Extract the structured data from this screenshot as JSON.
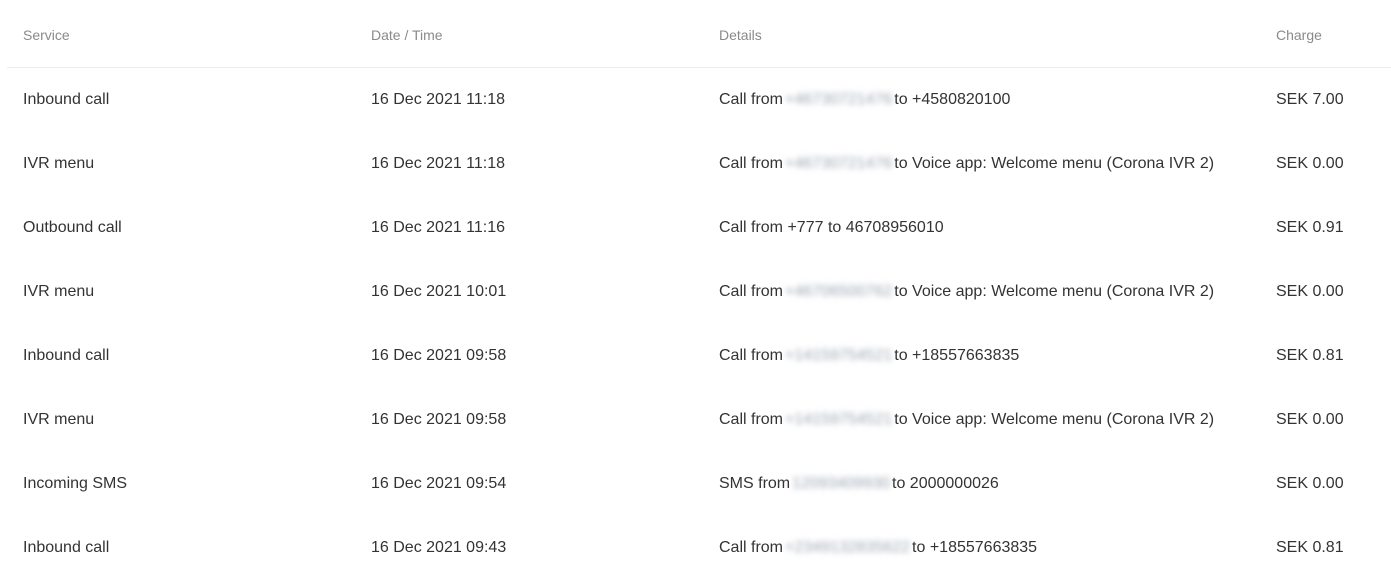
{
  "table": {
    "headers": {
      "service": "Service",
      "date_time": "Date / Time",
      "details": "Details",
      "charge": "Charge"
    },
    "rows": [
      {
        "service": "Inbound call",
        "date_time": "16 Dec 2021 11:18",
        "details_prefix": "Call from",
        "details_blurred": "+46730721476",
        "details_suffix": "to +4580820100",
        "charge": "SEK 7.00"
      },
      {
        "service": "IVR menu",
        "date_time": "16 Dec 2021 11:18",
        "details_prefix": "Call from",
        "details_blurred": "+46730721476",
        "details_suffix": "to Voice app: Welcome menu (Corona IVR 2)",
        "charge": "SEK 0.00"
      },
      {
        "service": "Outbound call",
        "date_time": "16 Dec 2021 11:16",
        "details_prefix": "Call from +777 to 46708956010",
        "details_blurred": null,
        "details_suffix": "",
        "charge": "SEK 0.91"
      },
      {
        "service": "IVR menu",
        "date_time": "16 Dec 2021 10:01",
        "details_prefix": "Call from",
        "details_blurred": "+46706500762",
        "details_suffix": "to Voice app: Welcome menu (Corona IVR 2)",
        "charge": "SEK 0.00"
      },
      {
        "service": "Inbound call",
        "date_time": "16 Dec 2021 09:58",
        "details_prefix": "Call from",
        "details_blurred": "+14159754521",
        "details_suffix": "to +18557663835",
        "charge": "SEK 0.81"
      },
      {
        "service": "IVR menu",
        "date_time": "16 Dec 2021 09:58",
        "details_prefix": "Call from",
        "details_blurred": "+14159754521",
        "details_suffix": "to Voice app: Welcome menu (Corona IVR 2)",
        "charge": "SEK 0.00"
      },
      {
        "service": "Incoming SMS",
        "date_time": "16 Dec 2021 09:54",
        "details_prefix": "SMS from",
        "details_blurred": "12093409930",
        "details_suffix": "to 2000000026",
        "charge": "SEK 0.00"
      },
      {
        "service": "Inbound call",
        "date_time": "16 Dec 2021 09:43",
        "details_prefix": "Call from",
        "details_blurred": "+2349132835622",
        "details_suffix": "to +18557663835",
        "charge": "SEK 0.81"
      }
    ]
  }
}
